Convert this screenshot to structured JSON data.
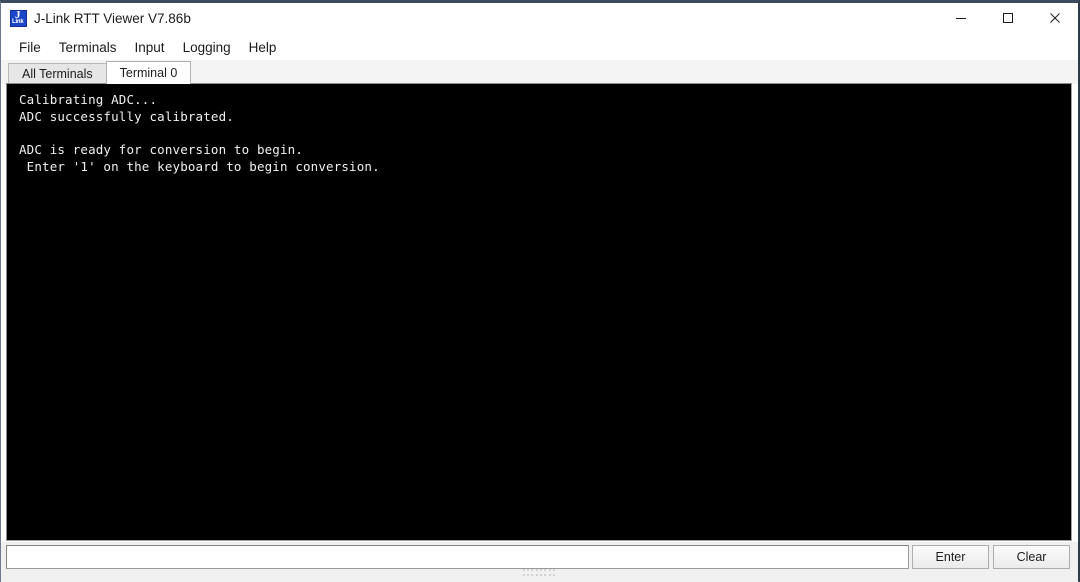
{
  "window": {
    "title": "J-Link RTT Viewer V7.86b",
    "icon": "jlink-logo-icon",
    "icon_glyph_primary": "J",
    "icon_glyph_secondary": "Link",
    "accent_color": "#1c46c8",
    "frame_color": "#3c4a5c",
    "controls": [
      {
        "name": "minimize",
        "label": "─"
      },
      {
        "name": "maximize",
        "label": "□"
      },
      {
        "name": "close",
        "label": "✕"
      }
    ]
  },
  "menubar": {
    "items": [
      {
        "label": "File"
      },
      {
        "label": "Terminals"
      },
      {
        "label": "Input"
      },
      {
        "label": "Logging"
      },
      {
        "label": "Help"
      }
    ]
  },
  "tabs": {
    "items": [
      {
        "label": "All Terminals",
        "active": false
      },
      {
        "label": "Terminal 0",
        "active": true
      }
    ]
  },
  "terminal": {
    "background_color": "#000000",
    "text_color": "#f0f0f0",
    "lines": [
      "Calibrating ADC...",
      "ADC successfully calibrated.",
      "",
      "ADC is ready for conversion to begin.",
      " Enter '1' on the keyboard to begin conversion."
    ],
    "content": "Calibrating ADC...\nADC successfully calibrated.\n\nADC is ready for conversion to begin.\n Enter '1' on the keyboard to begin conversion."
  },
  "bottom_bar": {
    "input": {
      "value": "",
      "placeholder": ""
    },
    "enter_label": "Enter",
    "clear_label": "Clear",
    "grip": "splitter-grip"
  }
}
